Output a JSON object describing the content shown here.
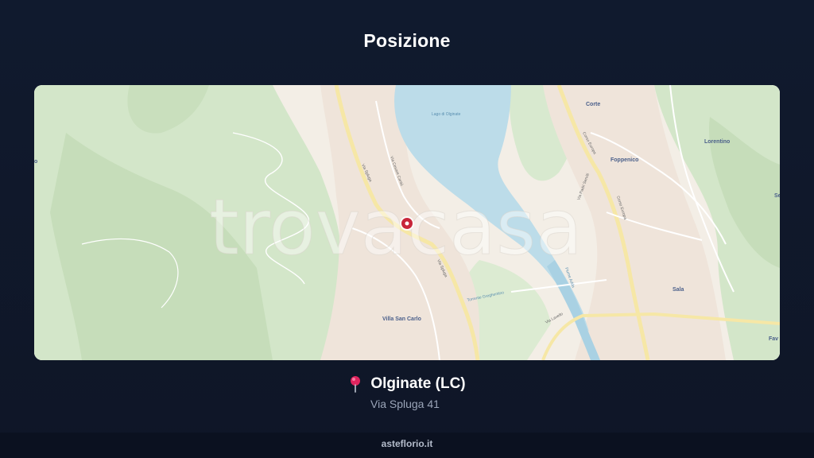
{
  "header": {
    "title": "Posizione"
  },
  "map": {
    "watermark": "trovacasa",
    "labels": {
      "corte": "Corte",
      "lorentino": "Lorentino",
      "foppenico": "Foppenico",
      "sala": "Sala",
      "villa_san_carlo": "Villa San Carlo",
      "se_partial": "Se",
      "fav_partial": "Fav",
      "o_partial": "o"
    },
    "streets": {
      "via_spluga_n": "Via Spluga",
      "via_spluga_s": "Via Spluga",
      "corso_europa_n": "Corso Europa",
      "corso_europa_s": "Corso Europa",
      "via_lavello": "Via Lavello",
      "via_cesare_cantu": "Via Cesare Cantù",
      "lago": "Lago di Olginate",
      "via_papa_sereni": "Via Padri Serviti",
      "adda": "Fiume Adda",
      "rio": "Torrente Greghentino",
      "via_lecco": "Via Spluga",
      "via_dante": "Via Dante"
    },
    "marker_icon": "map-marker-icon"
  },
  "location": {
    "icon": "pushpin-icon",
    "city": "Olginate (LC)",
    "address": "Via Spluga 41"
  },
  "footer": {
    "site": "asteflorio.it"
  },
  "colors": {
    "background": "#101a2e",
    "map_land": "#f3efe7",
    "map_forest": "#cfe3c4",
    "map_water": "#b9dcea",
    "marker": "#c8263a"
  }
}
